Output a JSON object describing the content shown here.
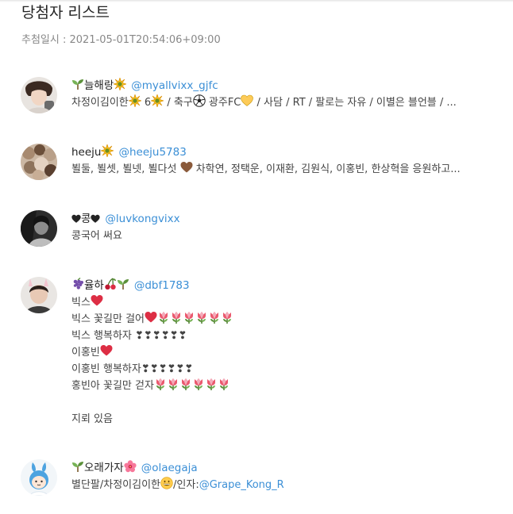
{
  "header": {
    "title": "당첨자 리스트",
    "draw_time": "추첨일시 : 2021-05-01T20:54:06+09:00"
  },
  "winners": [
    {
      "name": "늘해랑",
      "handle": "@myallvixx_gjfc",
      "bio": [
        "차정이김이한",
        "6",
        "/ 축구",
        "광주FC",
        "/ 사담 / RT / 팔로는 자유 / 이별은 블언블 / ..."
      ]
    },
    {
      "name": "heeju",
      "handle": "@heeju5783",
      "bio": [
        "뵐둘, 뵐셋, 뵐넷, 뵐다섯",
        "차학연, 정택운, 이재환, 김원식, 이홍빈, 한상혁을 응원하고..."
      ]
    },
    {
      "name": "콩",
      "handle": "@luvkongvixx",
      "bio": [
        "콩국어 써요"
      ]
    },
    {
      "name": "율하",
      "handle": "@dbf1783",
      "bio": [
        "빅스",
        "빅스 꽃길만 걸어",
        "빅스 행복하자 ❣❣❣❣❣❣",
        "이홍빈",
        "이홍빈 행복하자❣❣❣❣❣❣",
        "홍빈아 꽃길만 걷자",
        "",
        "지뢰 있음"
      ]
    },
    {
      "name": "오래가자",
      "handle": "@olaegaja",
      "bio": [
        "별단팔/차정이김이한",
        "/인자:",
        "@Grape_Kong_R"
      ]
    }
  ],
  "icons": {
    "sprout": "seedling-icon",
    "sparkle": "sparkle-icon",
    "soccer": "soccer-ball-icon",
    "yellow_heart": "yellow-heart-icon",
    "brown_heart": "brown-heart-icon",
    "black_heart": "black-heart-icon",
    "grapes": "grapes-icon",
    "cherries": "cherries-icon",
    "red_heart": "red-heart-icon",
    "tulip": "tulip-icon",
    "hibiscus": "hibiscus-icon",
    "grin": "grinning-face-icon"
  },
  "colors": {
    "link": "#3b8fd6",
    "title": "#222222",
    "meta": "#888888"
  }
}
